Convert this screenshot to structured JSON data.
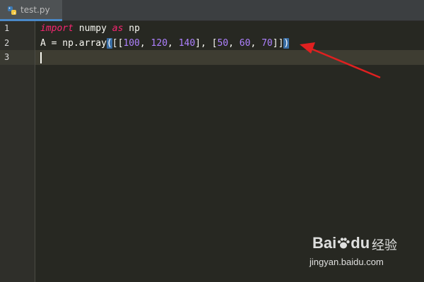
{
  "tab": {
    "filename": "test.py",
    "icon": "python-file-icon"
  },
  "gutter": {
    "line_numbers": [
      "1",
      "2",
      "3"
    ]
  },
  "code": {
    "line1": {
      "kw_import": "import",
      "module": " numpy ",
      "kw_as": "as",
      "alias": " np"
    },
    "line2": {
      "prefix": "A = np.array",
      "open_paren": "(",
      "b1": "[[",
      "n1": "100",
      "c1": ", ",
      "n2": "120",
      "c2": ", ",
      "n3": "140",
      "mid": "], [",
      "n4": "50",
      "c3": ", ",
      "n5": "60",
      "c4": ", ",
      "n6": "70",
      "b2": "]]",
      "close_paren": ")"
    },
    "line3": ""
  },
  "colors": {
    "keyword": "#f92672",
    "number": "#ae81ff",
    "text": "#f8f8f2",
    "background": "#272822",
    "annotation_arrow": "#e02020"
  },
  "watermark": {
    "brand": "Bai",
    "brand_tail": "du",
    "chinese": "经验",
    "url": "jingyan.baidu.com"
  }
}
